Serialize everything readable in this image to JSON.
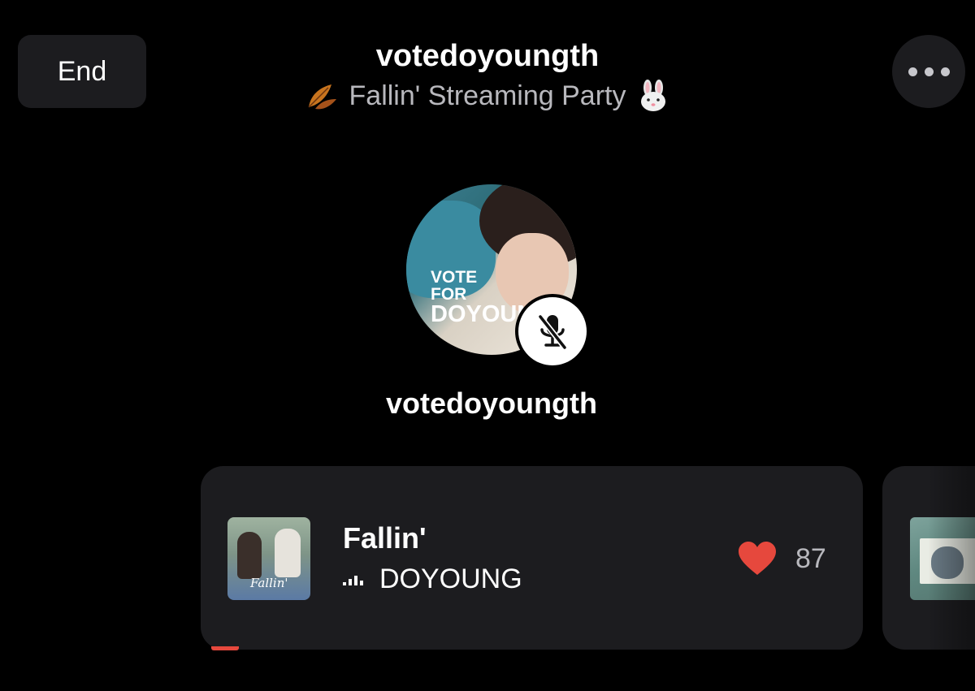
{
  "topbar": {
    "end_label": "End",
    "more_icon": "ellipsis-icon"
  },
  "header": {
    "host": "votedoyoungth",
    "subtitle": "Fallin' Streaming Party",
    "leading_emoji": "fallen-leaf-icon",
    "trailing_emoji": "rabbit-face-icon"
  },
  "speaker": {
    "name": "votedoyoungth",
    "avatar_text": [
      "VOTE",
      "FOR",
      "DOYOUNG"
    ],
    "muted": true,
    "mute_icon": "mic-off-icon"
  },
  "now_playing": {
    "title": "Fallin'",
    "artist": "DOYOUNG",
    "cover_text": "Fallin'",
    "likes": "87",
    "like_icon": "heart-icon",
    "playing_icon": "equalizer-icon",
    "accent_color": "#e6483d"
  }
}
